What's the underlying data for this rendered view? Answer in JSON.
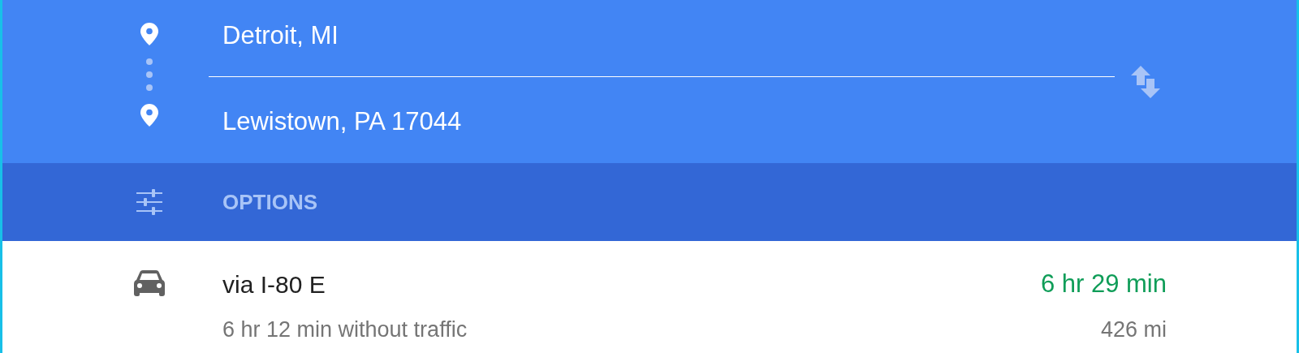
{
  "directions": {
    "origin": "Detroit, MI",
    "destination": "Lewistown, PA 17044"
  },
  "options": {
    "label": "OPTIONS"
  },
  "routes": [
    {
      "kind": "car",
      "title": "via I-80 E",
      "duration": "6 hr 29 min",
      "subtitle": "6 hr 12 min without traffic",
      "distance": "426 mi"
    }
  ]
}
